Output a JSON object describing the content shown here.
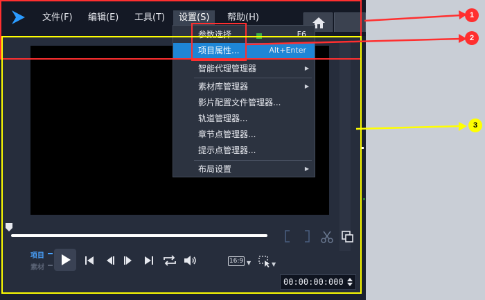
{
  "menu": {
    "items": [
      {
        "label": "文件(F)"
      },
      {
        "label": "编辑(E)"
      },
      {
        "label": "工具(T)"
      },
      {
        "label": "设置(S)"
      },
      {
        "label": "帮助(H)"
      }
    ]
  },
  "dropdown": {
    "items": [
      {
        "label": "参数选择...",
        "shortcut": "F6"
      },
      {
        "label": "项目属性...",
        "shortcut": "Alt+Enter"
      },
      {
        "label": "智能代理管理器"
      },
      {
        "label": "素材库管理器"
      },
      {
        "label": "影片配置文件管理器..."
      },
      {
        "label": "轨道管理器..."
      },
      {
        "label": "章节点管理器..."
      },
      {
        "label": "提示点管理器..."
      },
      {
        "label": "布局设置"
      }
    ]
  },
  "player": {
    "project_label": "项目",
    "clip_label": "素材",
    "aspect_ratio": "16:9",
    "timecode": "00:00:00:000"
  },
  "annotations": {
    "badges": [
      "1",
      "2",
      "3"
    ],
    "colors": {
      "red": "#ff2f2f",
      "yellow": "#ffff00"
    }
  },
  "colors": {
    "accent": "#1e86d6",
    "app_bg": "#1b2130",
    "menubar_bg": "#141925"
  }
}
